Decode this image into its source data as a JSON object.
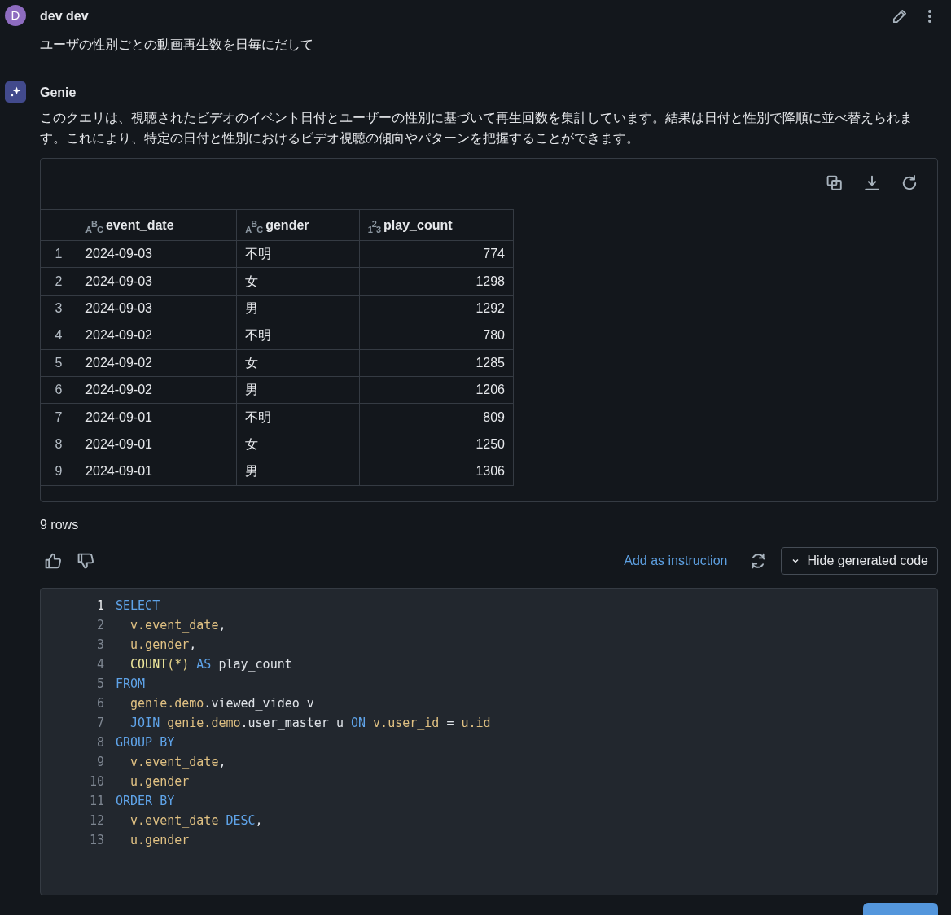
{
  "user_message": {
    "avatar_letter": "D",
    "author": "dev dev",
    "text": "ユーザの性別ごとの動画再生数を日毎にだして"
  },
  "reply": {
    "author": "Genie",
    "text": "このクエリは、視聴されたビデオのイベント日付とユーザーの性別に基づいて再生回数を集計しています。結果は日付と性別で降順に並べ替えられます。これにより、特定の日付と性別におけるビデオ視聴の傾向やパターンを把握することができます。"
  },
  "table": {
    "columns": [
      {
        "name": "event_date",
        "kind": "text",
        "type_glyphs": [
          "A",
          "B",
          "C"
        ]
      },
      {
        "name": "gender",
        "kind": "text",
        "type_glyphs": [
          "A",
          "B",
          "C"
        ]
      },
      {
        "name": "play_count",
        "kind": "number",
        "type_glyphs": [
          "1",
          "2",
          "3"
        ]
      }
    ],
    "rows": [
      {
        "number": "1",
        "cells": [
          "2024-09-03",
          "不明",
          "774"
        ]
      },
      {
        "number": "2",
        "cells": [
          "2024-09-03",
          "女",
          "1298"
        ]
      },
      {
        "number": "3",
        "cells": [
          "2024-09-03",
          "男",
          "1292"
        ]
      },
      {
        "number": "4",
        "cells": [
          "2024-09-02",
          "不明",
          "780"
        ]
      },
      {
        "number": "5",
        "cells": [
          "2024-09-02",
          "女",
          "1285"
        ]
      },
      {
        "number": "6",
        "cells": [
          "2024-09-02",
          "男",
          "1206"
        ]
      },
      {
        "number": "7",
        "cells": [
          "2024-09-01",
          "不明",
          "809"
        ]
      },
      {
        "number": "8",
        "cells": [
          "2024-09-01",
          "女",
          "1250"
        ]
      },
      {
        "number": "9",
        "cells": [
          "2024-09-01",
          "男",
          "1306"
        ]
      }
    ],
    "row_count": "9 rows"
  },
  "actions": {
    "link": "Add as instruction",
    "toggle_button": "Hide generated code"
  },
  "code": [
    {
      "number": "1",
      "selected": true,
      "indent": false,
      "tokens": [
        {
          "kind": "kw",
          "text": "SELECT"
        }
      ]
    },
    {
      "number": "2",
      "selected": false,
      "indent": true,
      "tokens": [
        {
          "kind": "id",
          "text": "v.event_date"
        },
        {
          "kind": "plain",
          "text": ","
        }
      ]
    },
    {
      "number": "3",
      "selected": false,
      "indent": true,
      "tokens": [
        {
          "kind": "id",
          "text": "u.gender"
        },
        {
          "kind": "plain",
          "text": ","
        }
      ]
    },
    {
      "number": "4",
      "selected": false,
      "indent": true,
      "tokens": [
        {
          "kind": "fn",
          "text": "COUNT"
        },
        {
          "kind": "paren",
          "text": "(*)"
        },
        {
          "kind": "kw",
          "text": " AS"
        },
        {
          "kind": "plain",
          "text": " play_count"
        }
      ]
    },
    {
      "number": "5",
      "selected": false,
      "indent": false,
      "tokens": [
        {
          "kind": "kw",
          "text": "FROM"
        }
      ]
    },
    {
      "number": "6",
      "selected": false,
      "indent": true,
      "tokens": [
        {
          "kind": "id",
          "text": "genie.demo"
        },
        {
          "kind": "plain",
          "text": ".viewed_video v"
        }
      ]
    },
    {
      "number": "7",
      "selected": false,
      "indent": true,
      "tokens": [
        {
          "kind": "kw",
          "text": "JOIN"
        },
        {
          "kind": "id",
          "text": " genie.demo"
        },
        {
          "kind": "plain",
          "text": ".user_master u"
        },
        {
          "kind": "kw",
          "text": " ON"
        },
        {
          "kind": "id",
          "text": " v.user_id"
        },
        {
          "kind": "plain",
          "text": " ="
        },
        {
          "kind": "id",
          "text": " u.id"
        }
      ]
    },
    {
      "number": "8",
      "selected": false,
      "indent": false,
      "tokens": [
        {
          "kind": "kw",
          "text": "GROUP BY"
        }
      ]
    },
    {
      "number": "9",
      "selected": false,
      "indent": true,
      "tokens": [
        {
          "kind": "id",
          "text": "v.event_date"
        },
        {
          "kind": "plain",
          "text": ","
        }
      ]
    },
    {
      "number": "10",
      "selected": false,
      "indent": true,
      "tokens": [
        {
          "kind": "id",
          "text": "u.gender"
        }
      ]
    },
    {
      "number": "11",
      "selected": false,
      "indent": false,
      "tokens": [
        {
          "kind": "kw",
          "text": "ORDER BY"
        }
      ]
    },
    {
      "number": "12",
      "selected": false,
      "indent": true,
      "tokens": [
        {
          "kind": "id",
          "text": "v.event_date"
        },
        {
          "kind": "kw",
          "text": " DESC"
        },
        {
          "kind": "plain",
          "text": ","
        }
      ]
    },
    {
      "number": "13",
      "selected": false,
      "indent": true,
      "tokens": [
        {
          "kind": "id",
          "text": "u.gender"
        }
      ]
    }
  ]
}
